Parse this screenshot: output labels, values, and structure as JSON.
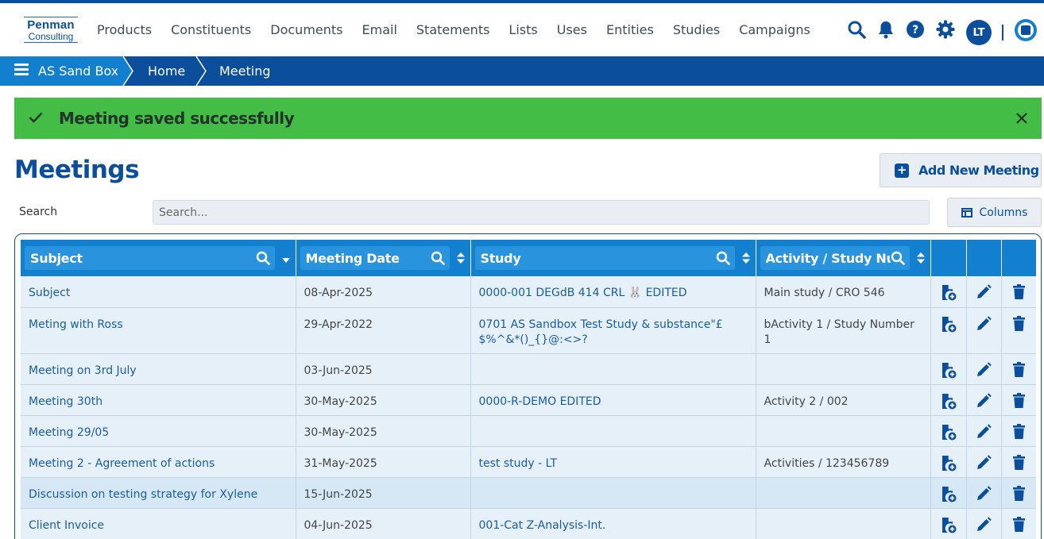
{
  "brand": {
    "line1": "Penman",
    "line2": "Consulting"
  },
  "nav": [
    "Products",
    "Constituents",
    "Documents",
    "Email",
    "Statements",
    "Lists",
    "Uses",
    "Entities",
    "Studies",
    "Campaigns"
  ],
  "user": {
    "initials": "LT"
  },
  "breadcrumb": {
    "workspace": "AS Sand Box",
    "home": "Home",
    "current": "Meeting"
  },
  "alert": {
    "message": "Meeting saved successfully"
  },
  "page": {
    "title": "Meetings",
    "add_label": "Add New Meeting",
    "search_label": "Search",
    "search_placeholder": "Search...",
    "columns_label": "Columns"
  },
  "table": {
    "headers": [
      "Subject",
      "Meeting Date",
      "Study",
      "Activity / Study Nur"
    ],
    "rows": [
      {
        "subject": "Subject",
        "date": "08-Apr-2025",
        "study": "0000-001 DEGdB 414 CRL 🐰 EDITED",
        "activity": "Main study / CRO 546"
      },
      {
        "subject": "Meting with Ross",
        "date": "29-Apr-2022",
        "study": "0701 AS Sandbox Test Study & substance\"£$%^&*()_{}@:<>?",
        "activity": "bActivity 1 / Study Number 1"
      },
      {
        "subject": "Meeting on 3rd July",
        "date": "03-Jun-2025",
        "study": "",
        "activity": ""
      },
      {
        "subject": "Meeting 30th",
        "date": "30-May-2025",
        "study": "0000-R-DEMO EDITED",
        "activity": "Activity 2 / 002"
      },
      {
        "subject": "Meeting 29/05",
        "date": "30-May-2025",
        "study": "",
        "activity": ""
      },
      {
        "subject": "Meeting 2 - Agreement of actions",
        "date": "31-May-2025",
        "study": "test study - LT",
        "activity": "Activities / 123456789"
      },
      {
        "subject": "Discussion on testing strategy for Xylene",
        "date": "15-Jun-2025",
        "study": "",
        "activity": ""
      },
      {
        "subject": "Client Invoice",
        "date": "04-Jun-2025",
        "study": "001-Cat Z-Analysis-Int.",
        "activity": ""
      }
    ]
  },
  "colors": {
    "primary": "#0b4f9c",
    "header": "#1380cf",
    "success": "#44bd46",
    "row": "#e6f0f8"
  }
}
